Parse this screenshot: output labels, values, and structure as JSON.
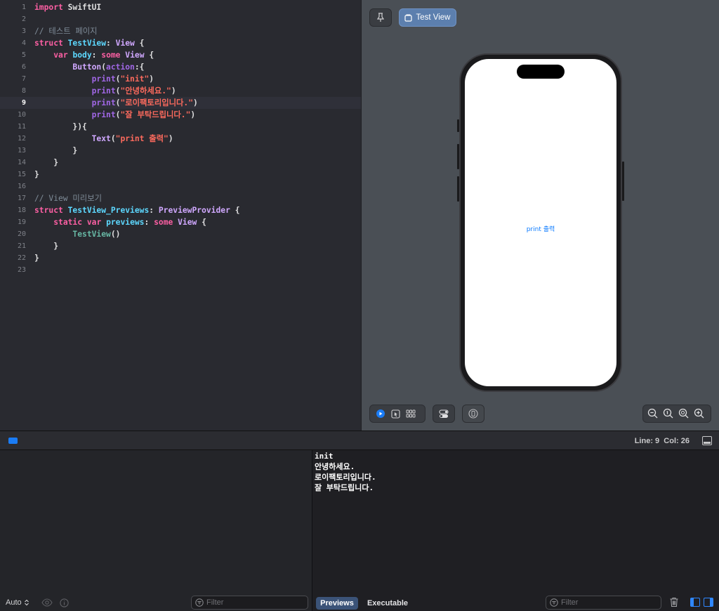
{
  "editor": {
    "current_line": 9,
    "lines": [
      {
        "n": "1",
        "t": [
          [
            "kw",
            "import"
          ],
          [
            "pl",
            " SwiftUI"
          ]
        ]
      },
      {
        "n": "2",
        "t": []
      },
      {
        "n": "3",
        "t": [
          [
            "cm",
            "// 테스트 페이지"
          ]
        ]
      },
      {
        "n": "4",
        "t": [
          [
            "kw",
            "struct"
          ],
          [
            "pl",
            " "
          ],
          [
            "type",
            "TestView"
          ],
          [
            "pl",
            ": "
          ],
          [
            "ptype",
            "View"
          ],
          [
            "pl",
            " {"
          ]
        ]
      },
      {
        "n": "5",
        "t": [
          [
            "pl",
            "    "
          ],
          [
            "kw",
            "var"
          ],
          [
            "pl",
            " "
          ],
          [
            "type",
            "body"
          ],
          [
            "pl",
            ": "
          ],
          [
            "kw",
            "some"
          ],
          [
            "pl",
            " "
          ],
          [
            "ptype",
            "View"
          ],
          [
            "pl",
            " {"
          ]
        ]
      },
      {
        "n": "6",
        "t": [
          [
            "pl",
            "        "
          ],
          [
            "ptype",
            "Button"
          ],
          [
            "pl",
            "("
          ],
          [
            "call",
            "action"
          ],
          [
            "pl",
            ":{"
          ]
        ]
      },
      {
        "n": "7",
        "t": [
          [
            "pl",
            "            "
          ],
          [
            "call",
            "print"
          ],
          [
            "pl",
            "("
          ],
          [
            "str",
            "\"init\""
          ],
          [
            "pl",
            ")"
          ]
        ]
      },
      {
        "n": "8",
        "t": [
          [
            "pl",
            "            "
          ],
          [
            "call",
            "print"
          ],
          [
            "pl",
            "("
          ],
          [
            "str",
            "\"안녕하세요.\""
          ],
          [
            "pl",
            ")"
          ]
        ]
      },
      {
        "n": "9",
        "t": [
          [
            "pl",
            "            "
          ],
          [
            "call",
            "print"
          ],
          [
            "pl",
            "("
          ],
          [
            "str",
            "\"로이팩토리입니다.\""
          ],
          [
            "pl",
            ")"
          ]
        ]
      },
      {
        "n": "10",
        "t": [
          [
            "pl",
            "            "
          ],
          [
            "call",
            "print"
          ],
          [
            "pl",
            "("
          ],
          [
            "str",
            "\"잘 부탁드립니다.\""
          ],
          [
            "pl",
            ")"
          ]
        ]
      },
      {
        "n": "11",
        "t": [
          [
            "pl",
            "        }){"
          ]
        ]
      },
      {
        "n": "12",
        "t": [
          [
            "pl",
            "            "
          ],
          [
            "ptype",
            "Text"
          ],
          [
            "pl",
            "("
          ],
          [
            "str",
            "\"print 출력\""
          ],
          [
            "pl",
            ")"
          ]
        ]
      },
      {
        "n": "13",
        "t": [
          [
            "pl",
            "        }"
          ]
        ]
      },
      {
        "n": "14",
        "t": [
          [
            "pl",
            "    }"
          ]
        ]
      },
      {
        "n": "15",
        "t": [
          [
            "pl",
            "}"
          ]
        ]
      },
      {
        "n": "16",
        "t": []
      },
      {
        "n": "17",
        "t": [
          [
            "cm",
            "// View 미리보기"
          ]
        ]
      },
      {
        "n": "18",
        "t": [
          [
            "kw",
            "struct"
          ],
          [
            "pl",
            " "
          ],
          [
            "type",
            "TestView_Previews"
          ],
          [
            "pl",
            ": "
          ],
          [
            "ptype",
            "PreviewProvider"
          ],
          [
            "pl",
            " {"
          ]
        ]
      },
      {
        "n": "19",
        "t": [
          [
            "pl",
            "    "
          ],
          [
            "kw",
            "static"
          ],
          [
            "pl",
            " "
          ],
          [
            "kw",
            "var"
          ],
          [
            "pl",
            " "
          ],
          [
            "type",
            "previews"
          ],
          [
            "pl",
            ": "
          ],
          [
            "kw",
            "some"
          ],
          [
            "pl",
            " "
          ],
          [
            "ptype",
            "View"
          ],
          [
            "pl",
            " {"
          ]
        ]
      },
      {
        "n": "20",
        "t": [
          [
            "pl",
            "        "
          ],
          [
            "ident",
            "TestView"
          ],
          [
            "pl",
            "()"
          ]
        ]
      },
      {
        "n": "21",
        "t": [
          [
            "pl",
            "    }"
          ]
        ]
      },
      {
        "n": "22",
        "t": [
          [
            "pl",
            "}"
          ]
        ]
      },
      {
        "n": "23",
        "t": []
      }
    ]
  },
  "preview": {
    "tab_label": "Test View",
    "screen_button_label": "print 출력"
  },
  "status_bar": {
    "line_label": "Line:",
    "line_value": "9",
    "col_label": "Col:",
    "col_value": "26"
  },
  "variables_pane": {
    "scope_select": "Auto",
    "filter_placeholder": "Filter"
  },
  "console": {
    "lines": [
      "init",
      "안녕하세요.",
      "로이팩토리입니다.",
      "잘 부탁드립니다."
    ],
    "segments": {
      "previews": "Previews",
      "executable": "Executable"
    },
    "filter_placeholder": "Filter"
  },
  "colors": {
    "keyword": "#fc5fa3",
    "type_decl": "#5dd8ff",
    "project_type": "#d0a8ff",
    "string": "#fc6a5d",
    "comment": "#7f8c98",
    "accent": "#0a7aff"
  }
}
